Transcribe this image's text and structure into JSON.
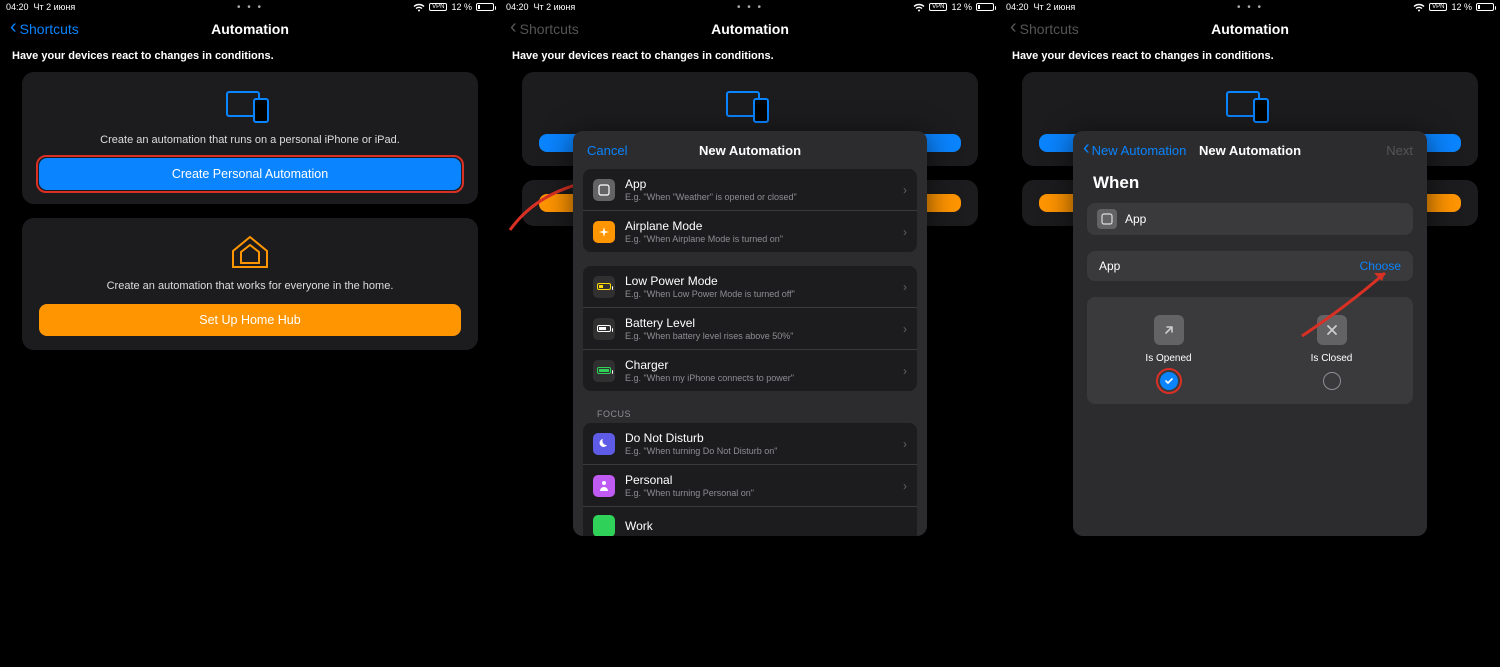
{
  "status": {
    "time": "04:20",
    "date": "Чт 2 июня",
    "dots": "• • •",
    "battery": "12 %"
  },
  "nav": {
    "back": "Shortcuts",
    "title": "Automation"
  },
  "subtitle": "Have your devices react to changes in conditions.",
  "card1": {
    "desc": "Create an automation that runs on a personal iPhone or iPad.",
    "button": "Create Personal Automation"
  },
  "card2": {
    "desc": "Create an automation that works for everyone in the home.",
    "button": "Set Up Home Hub"
  },
  "modal2": {
    "cancel": "Cancel",
    "title": "New Automation",
    "rows": [
      {
        "title": "App",
        "sub": "E.g. \"When \"Weather\" is opened or closed\""
      },
      {
        "title": "Airplane Mode",
        "sub": "E.g. \"When Airplane Mode is turned on\""
      },
      {
        "title": "Low Power Mode",
        "sub": "E.g. \"When Low Power Mode is turned off\""
      },
      {
        "title": "Battery Level",
        "sub": "E.g. \"When battery level rises above 50%\""
      },
      {
        "title": "Charger",
        "sub": "E.g. \"When my iPhone connects to power\""
      },
      {
        "title": "Do Not Disturb",
        "sub": "E.g. \"When turning Do Not Disturb on\""
      },
      {
        "title": "Personal",
        "sub": "E.g. \"When turning Personal on\""
      },
      {
        "title": "Work",
        "sub": ""
      }
    ],
    "focus_label": "FOCUS"
  },
  "modal3": {
    "back": "New Automation",
    "title": "New Automation",
    "next": "Next",
    "when": "When",
    "app_label": "App",
    "app_row_label": "App",
    "choose": "Choose",
    "opt_opened": "Is Opened",
    "opt_closed": "Is Closed"
  }
}
